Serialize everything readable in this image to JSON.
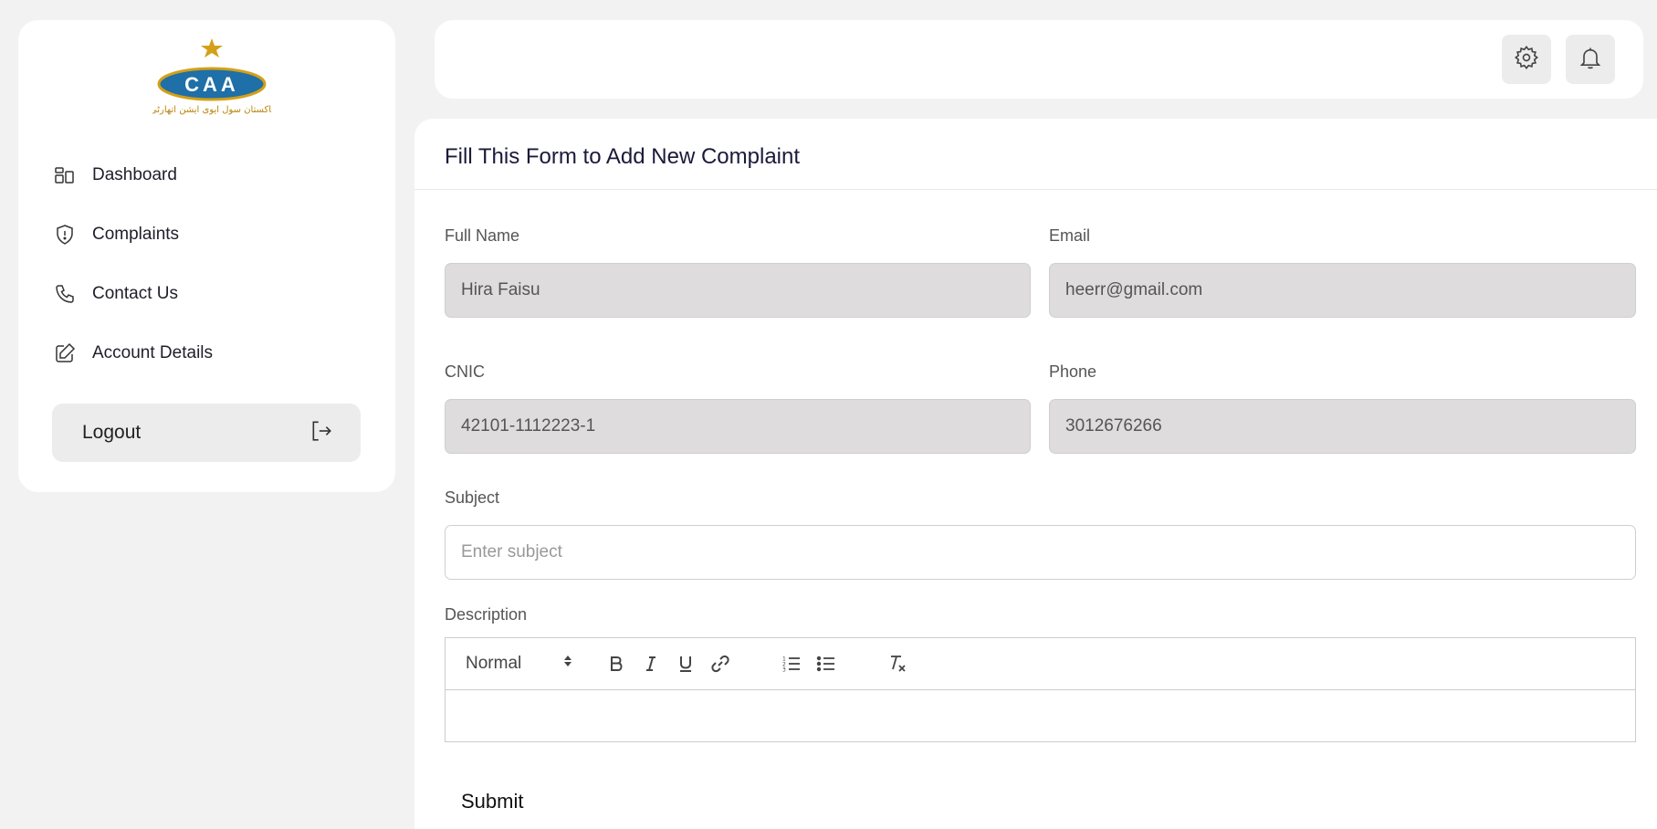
{
  "app": {
    "logo_text": "CAA",
    "logo_urdu_text": "پاکستان سول ایوی ایشن اتھارٹی"
  },
  "sidebar": {
    "items": [
      {
        "label": "Dashboard",
        "icon": "dashboard-icon"
      },
      {
        "label": "Complaints",
        "icon": "shield-icon"
      },
      {
        "label": "Contact Us",
        "icon": "phone-icon"
      },
      {
        "label": "Account Details",
        "icon": "edit-icon"
      }
    ],
    "logout_label": "Logout"
  },
  "header": {
    "settings_icon": "gear-icon",
    "notifications_icon": "bell-icon"
  },
  "form": {
    "title": "Fill This Form to Add New Complaint",
    "full_name": {
      "label": "Full Name",
      "value": "Hira Faisu"
    },
    "email": {
      "label": "Email",
      "value": "heerr@gmail.com"
    },
    "cnic": {
      "label": "CNIC",
      "value": "42101-1112223-1"
    },
    "phone": {
      "label": "Phone",
      "value": "3012676266"
    },
    "subject": {
      "label": "Subject",
      "placeholder": "Enter subject",
      "value": ""
    },
    "description": {
      "label": "Description",
      "format_select": "Normal",
      "toolbar_icons": [
        "bold-icon",
        "italic-icon",
        "underline-icon",
        "link-icon",
        "ordered-list-icon",
        "bullet-list-icon",
        "clear-format-icon"
      ]
    },
    "submit_label": "Submit"
  },
  "colors": {
    "accent_blue": "#1f6fa8",
    "logo_gold": "#d4a017",
    "input_readonly_bg": "#dedcdd"
  }
}
